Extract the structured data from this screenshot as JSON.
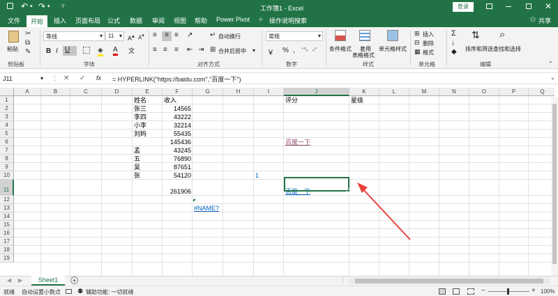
{
  "title": {
    "doc": "工作簿1 - Excel",
    "login": "登录",
    "share": "共享"
  },
  "menu": [
    "文件",
    "开始",
    "插入",
    "页面布局",
    "公式",
    "数据",
    "审阅",
    "视图",
    "帮助",
    "Power Pivot",
    "操作说明搜索"
  ],
  "ribbon": {
    "paste": "粘贴",
    "font_name": "等线",
    "font_size": "11",
    "wrap_text": "自动换行",
    "merge_center": "合并后居中",
    "number_format": "常规",
    "cond_format": "条件格式",
    "table_format_1": "套用",
    "table_format_2": "表格格式",
    "cell_style": "单元格样式",
    "insert": "插入",
    "delete": "删除",
    "format": "格式",
    "sort_filter": "排序和筛选",
    "find_select": "查找和选择",
    "groups": [
      "剪贴板",
      "字体",
      "对齐方式",
      "数字",
      "样式",
      "单元格",
      "编辑"
    ]
  },
  "formula_bar": {
    "name_box": "J11",
    "fx": "fx",
    "formula": "= HYPERLINK(\"https://baidu.com\",\"百度一下\")"
  },
  "columns": [
    "A",
    "B",
    "C",
    "D",
    "E",
    "F",
    "G",
    "H",
    "I",
    "J",
    "K",
    "L",
    "M",
    "N",
    "O",
    "P",
    "Q"
  ],
  "rows": [
    "1",
    "2",
    "3",
    "4",
    "5",
    "6",
    "7",
    "8",
    "9",
    "10",
    "11",
    "12",
    "13",
    "14",
    "15",
    "16",
    "17",
    "18",
    "19"
  ],
  "cells": {
    "E1": "姓名",
    "F1": "收入",
    "J1": "评分",
    "K1": "星级",
    "E2": "张三",
    "F2": "14565",
    "E3": "李四",
    "F3": "43222",
    "E4": "小李",
    "F4": "32214",
    "E5": "刘妈",
    "F5": "55435",
    "F6": "145436",
    "J6": "百度一下",
    "E7": "孟",
    "F7": "43245",
    "E8": "五",
    "F8": "76890",
    "E9": "吴",
    "F9": "87651",
    "E10": "张",
    "F10": "54120",
    "I10": "1",
    "F11": "261906",
    "J11": "百度一下",
    "G13": "#NAME?"
  },
  "sheet_tab": "Sheet1",
  "status": {
    "ready": "就绪",
    "auto_decimal": "自动设置小数点",
    "accessibility": "辅助功能: 一切就绪",
    "zoom": "100%"
  },
  "colors": {
    "brand": "#217346",
    "link": "#0563c1",
    "visited": "#954f72",
    "arrow": "#e8403a"
  }
}
